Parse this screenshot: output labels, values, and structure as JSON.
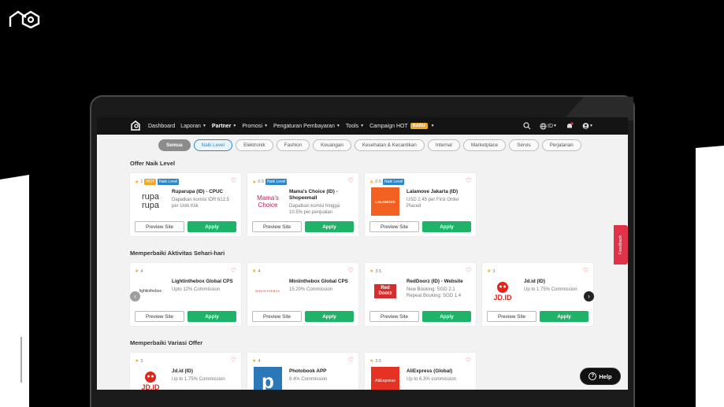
{
  "nav": {
    "items": [
      {
        "label": "Dashboard",
        "caret": false,
        "active": false
      },
      {
        "label": "Laporan",
        "caret": true,
        "active": false
      },
      {
        "label": "Partner",
        "caret": true,
        "active": true
      },
      {
        "label": "Promosi",
        "caret": true,
        "active": false
      },
      {
        "label": "Pengaturan Pembayaran",
        "caret": true,
        "active": false
      },
      {
        "label": "Tools",
        "caret": true,
        "active": false
      },
      {
        "label": "Campaign HOT",
        "caret": false,
        "active": false
      }
    ],
    "badge": "BARU",
    "lang": "ID"
  },
  "chips": [
    "Semua",
    "Naik Level",
    "Elektronik",
    "Fashion",
    "Keuangan",
    "Kesehatan & Kecantikan",
    "Internal",
    "Marketplace",
    "Servis",
    "Perjalanan"
  ],
  "sections": {
    "s1": "Offer Naik Level",
    "s2": "Memperbaiki Aktivitas Sehari-hari",
    "s3": "Memperbaiki Variasi Offer"
  },
  "buttons": {
    "preview": "Preview Site",
    "apply": "Apply"
  },
  "cards": {
    "c1": {
      "rating": "1",
      "hot": "HOT",
      "tag": "Naik Level",
      "name": "Ruparupa (ID) - CPUC",
      "desc": "Dapatkan komisi IDR 612.5 per Unik Klik",
      "logo": "rupa rupa"
    },
    "c2": {
      "rating": "0.5",
      "tag": "Naik Level",
      "name": "Mama's Choice (ID) - Shopeemall",
      "desc": "Dapatkan komisi hingga 10.5% per penjualan",
      "logo": "Mama's Choice"
    },
    "c3": {
      "rating": "0.5",
      "tag": "Naik Level",
      "name": "Lalamove Jakarta (ID)",
      "desc": "USD 2.45 per First Order Placed",
      "logo": "LALAMOVE"
    },
    "d1": {
      "rating": "4",
      "name": "Lightinthebox Global CPS",
      "desc": "Upto 12% Commission",
      "logo": "lightinthebox"
    },
    "d2": {
      "rating": "4",
      "name": "Miniinthebox Global CPS",
      "desc": "15.20% Commission",
      "logo": "MINIINTHEBOX"
    },
    "d3": {
      "rating": "3.5",
      "name": "RedDoorz (ID) - Website",
      "desc": "New Booking: SGD 2.1 Repeat Booking: SGD 1.4",
      "logo": "Red Doorz"
    },
    "d4": {
      "rating": "3",
      "name": "Jd.id (ID)",
      "desc": "Up to 1.75% Commission",
      "logo": "JD.ID"
    },
    "e1": {
      "rating": "3",
      "name": "Jd.id (ID)",
      "desc": "Up to 1.75% Commission",
      "logo": "JD.ID"
    },
    "e2": {
      "rating": "4",
      "name": "Photobook APP",
      "desc": "8.4% Commission",
      "logo": "p"
    },
    "e3": {
      "rating": "3.5",
      "name": "AliExpress (Global)",
      "desc": "Up to 6.3% commission",
      "logo": "AliExpress"
    }
  },
  "feedback": "Feedback",
  "help": "Help",
  "colors": {
    "accent_green": "#1fb36a",
    "accent_blue": "#2d86c7",
    "hot": "#f5a623",
    "feedback_red": "#e0334a"
  }
}
